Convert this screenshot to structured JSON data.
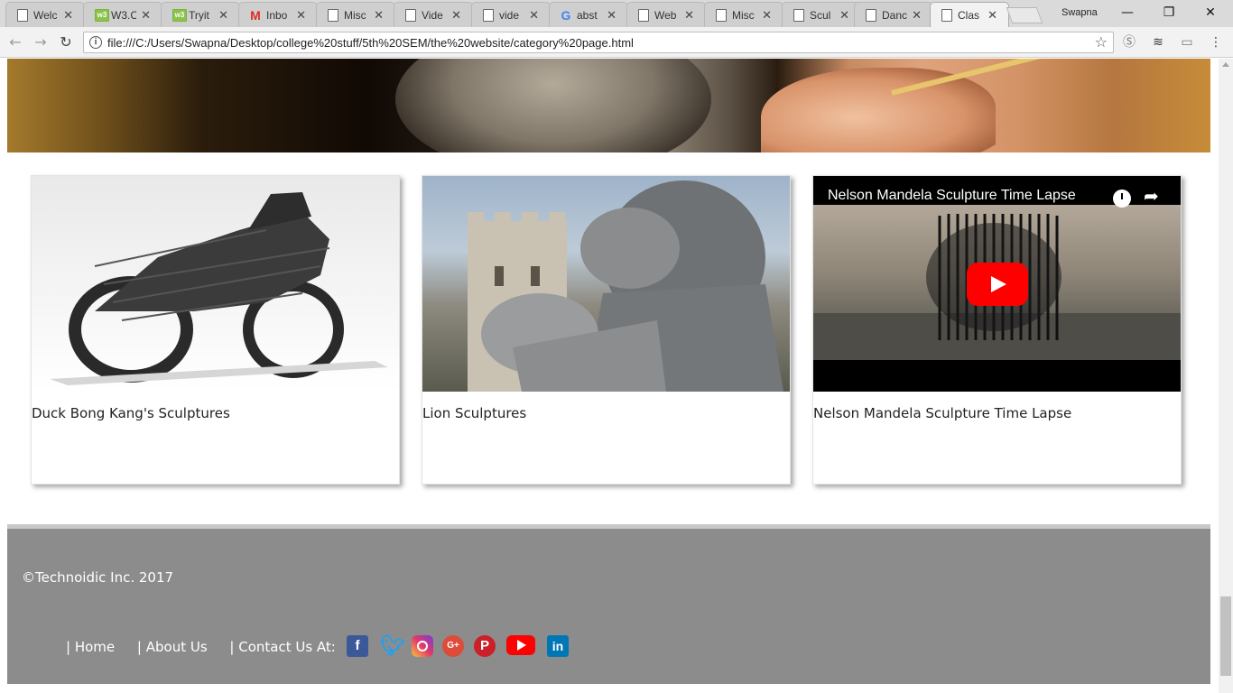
{
  "browser": {
    "tabs": [
      {
        "label": "Welc",
        "icon": "doc-icon"
      },
      {
        "label": "W3.C",
        "icon": "w3-icon"
      },
      {
        "label": "Tryit",
        "icon": "w3-icon"
      },
      {
        "label": "Inbo",
        "icon": "gmail-icon"
      },
      {
        "label": "Misc",
        "icon": "doc-icon"
      },
      {
        "label": "Vide",
        "icon": "doc-icon"
      },
      {
        "label": "vide",
        "icon": "doc-icon"
      },
      {
        "label": "abst",
        "icon": "google-icon"
      },
      {
        "label": "Web",
        "icon": "doc-icon"
      },
      {
        "label": "Misc",
        "icon": "doc-icon"
      },
      {
        "label": "Scul",
        "icon": "doc-icon"
      },
      {
        "label": "Danc",
        "icon": "doc-icon"
      },
      {
        "label": "Clas",
        "icon": "doc-icon",
        "active": true
      }
    ],
    "profile_name": "Swapna",
    "url": "file:///C:/Users/Swapna/Desktop/college%20stuff/5th%20SEM/the%20website/category%20page.html"
  },
  "cards": [
    {
      "caption": "Duck Bong Kang's Sculptures"
    },
    {
      "caption": "Lion Sculptures"
    },
    {
      "caption": "Nelson Mandela Sculpture Time Lapse",
      "video_title": "Nelson Mandela Sculpture Time Lapse"
    }
  ],
  "footer": {
    "copyright": "©Technoidic Inc. 2017",
    "links": [
      "| Home",
      "| About Us",
      "| Contact Us At:"
    ],
    "social": [
      "facebook-icon",
      "twitter-icon",
      "instagram-icon",
      "google-plus-icon",
      "pinterest-icon",
      "youtube-icon",
      "linkedin-icon"
    ],
    "social_labels": {
      "facebook": "f",
      "google_plus": "G+",
      "pinterest": "P",
      "linkedin": "in"
    }
  },
  "colors": {
    "footer_bg": "#8c8c8c",
    "youtube_red": "#ff0000"
  }
}
